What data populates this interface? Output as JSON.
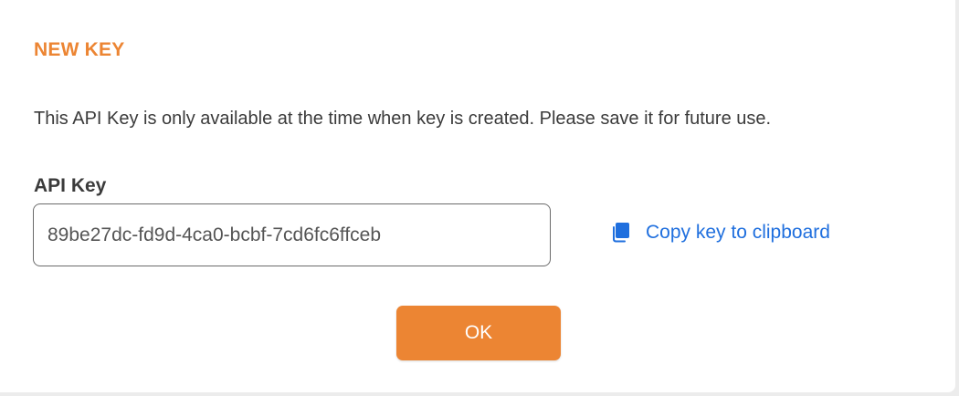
{
  "dialog": {
    "title": "NEW KEY",
    "message": "This API Key is only available at the time when key is created. Please save it for future use.",
    "field_label": "API Key",
    "api_key_value": "89be27dc-fd9d-4ca0-bcbf-7cd6fc6ffceb",
    "copy_label": "Copy key to clipboard",
    "copy_icon": "copy-icon",
    "ok_label": "OK"
  },
  "colors": {
    "accent": "#ec8533",
    "link": "#1f6fde",
    "text": "#3b3b3b"
  }
}
